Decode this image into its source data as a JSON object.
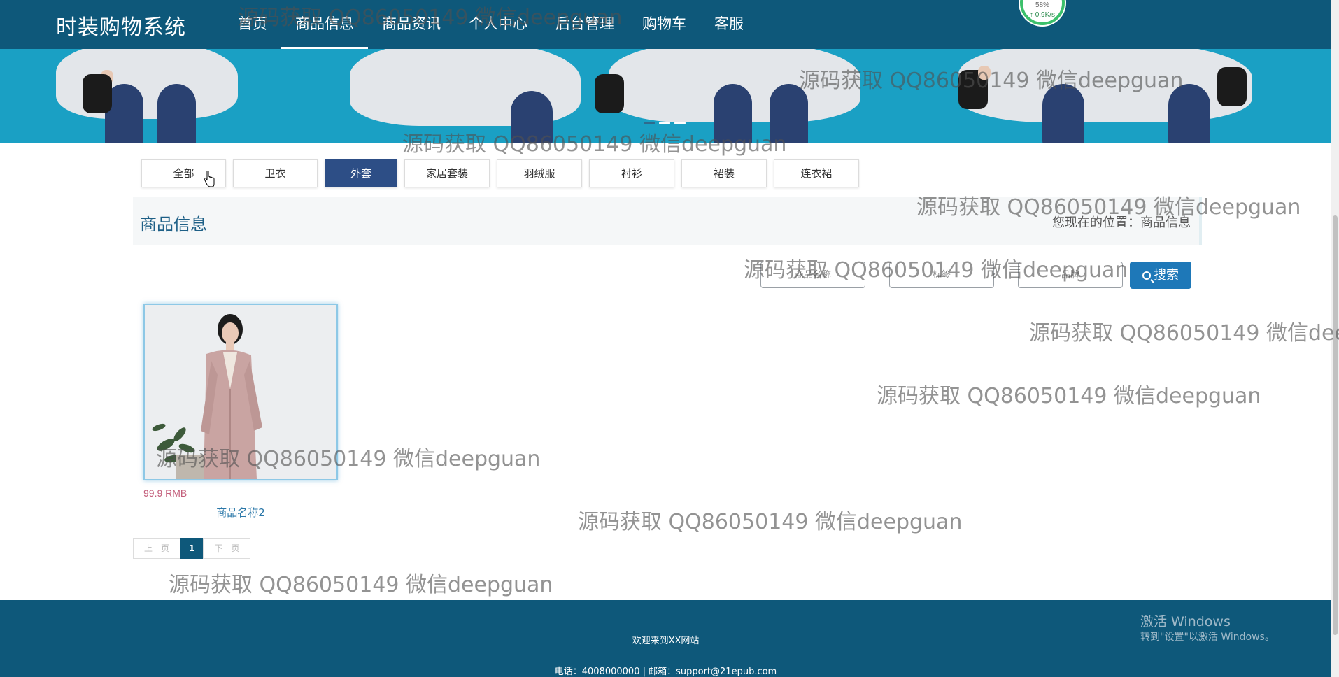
{
  "brand": {
    "name": "时装购物系统"
  },
  "nav": {
    "items": [
      {
        "label": "首页"
      },
      {
        "label": "商品信息"
      },
      {
        "label": "商品资讯"
      },
      {
        "label": "个人中心"
      },
      {
        "label": "后台管理"
      },
      {
        "label": "购物车"
      },
      {
        "label": "客服"
      }
    ],
    "active_index": 1
  },
  "speed_widget": {
    "percent": "58%",
    "rate": "↑ 0.9K/s"
  },
  "banner": {
    "slides": 3,
    "active_slide": 1
  },
  "categories": {
    "items": [
      "全部",
      "卫衣",
      "外套",
      "家居套装",
      "羽绒服",
      "衬衫",
      "裙装",
      "连衣裙"
    ],
    "active": "外套"
  },
  "section": {
    "title": "商品信息",
    "location_label": "您现在的位置：",
    "location_current": "商品信息"
  },
  "search": {
    "name_placeholder": "商品名称",
    "tag_placeholder": "标签",
    "brand_placeholder": "品牌",
    "button_label": "搜索"
  },
  "products": [
    {
      "name": "商品名称2",
      "price": "99.9 RMB"
    }
  ],
  "pagination": {
    "prev": "上一页",
    "current": "1",
    "next": "下一页"
  },
  "footer": {
    "welcome": "欢迎来到XX网站",
    "contact": "电话：4008000000 | 邮箱：support@21epub.com"
  },
  "windows_activation": {
    "title": "激活 Windows",
    "subtitle": "转到\"设置\"以激活 Windows。"
  },
  "watermark": {
    "text": "源码获取 QQ86050149 微信deepguan"
  },
  "colors": {
    "nav_bg": "#0e587a",
    "active_tab": "#2d4e86",
    "search_button": "#1e78b8",
    "price": "#c35d7a",
    "banner_bg": "#1aa0c4"
  }
}
